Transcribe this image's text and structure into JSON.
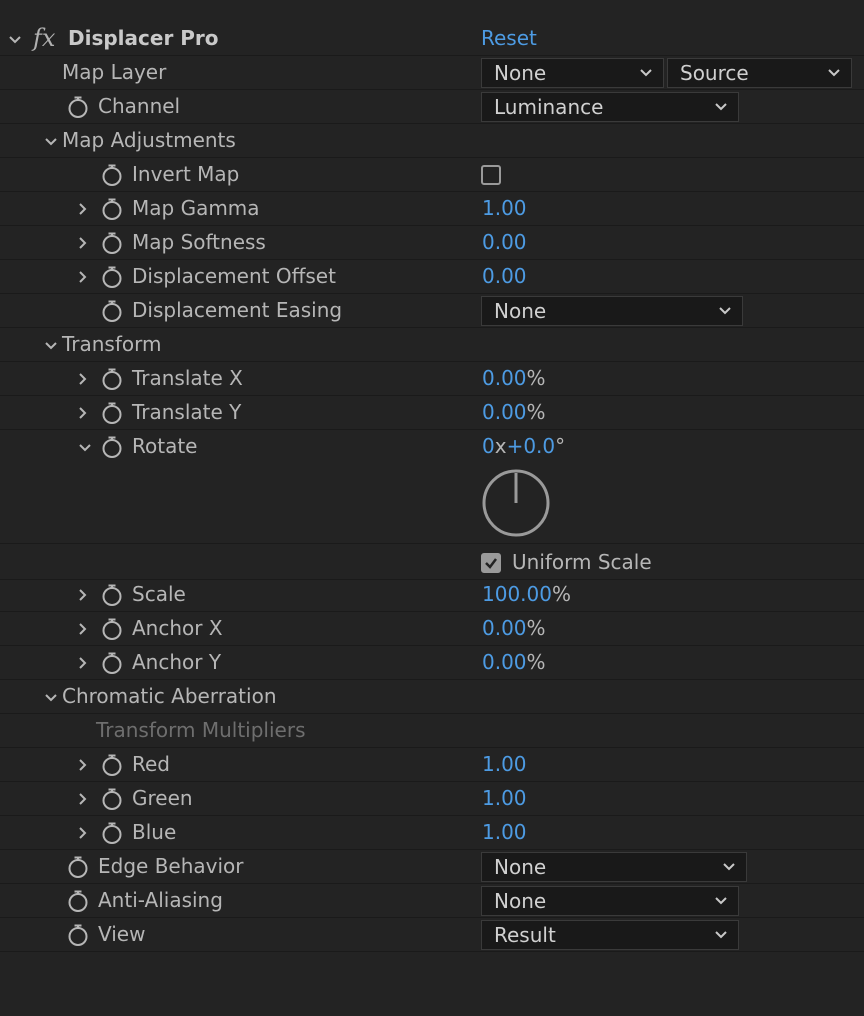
{
  "effect": {
    "name": "Displacer Pro",
    "fx_glyph": "fx",
    "reset_label": "Reset"
  },
  "map_layer": {
    "label": "Map Layer",
    "layer_value": "None",
    "source_value": "Source"
  },
  "channel": {
    "label": "Channel",
    "value": "Luminance"
  },
  "map_adjustments": {
    "label": "Map Adjustments",
    "invert_map": {
      "label": "Invert Map",
      "checked": false
    },
    "map_gamma": {
      "label": "Map Gamma",
      "value": "1.00"
    },
    "map_softness": {
      "label": "Map Softness",
      "value": "0.00"
    },
    "displacement_offset": {
      "label": "Displacement Offset",
      "value": "0.00"
    },
    "displacement_easing": {
      "label": "Displacement Easing",
      "value": "None"
    }
  },
  "transform": {
    "label": "Transform",
    "translate_x": {
      "label": "Translate X",
      "value": "0.00",
      "unit": "%"
    },
    "translate_y": {
      "label": "Translate Y",
      "value": "0.00",
      "unit": "%"
    },
    "rotate": {
      "label": "Rotate",
      "revolutions": "0",
      "rev_sep": "x",
      "degrees": "+0.0",
      "deg_unit": "°"
    },
    "uniform_scale": {
      "label": "Uniform Scale",
      "checked": true
    },
    "scale": {
      "label": "Scale",
      "value": "100.00",
      "unit": "%"
    },
    "anchor_x": {
      "label": "Anchor X",
      "value": "0.00",
      "unit": "%"
    },
    "anchor_y": {
      "label": "Anchor Y",
      "value": "0.00",
      "unit": "%"
    }
  },
  "chromatic_aberration": {
    "label": "Chromatic Aberration",
    "multipliers_label": "Transform Multipliers",
    "red": {
      "label": "Red",
      "value": "1.00"
    },
    "green": {
      "label": "Green",
      "value": "1.00"
    },
    "blue": {
      "label": "Blue",
      "value": "1.00"
    }
  },
  "edge_behavior": {
    "label": "Edge Behavior",
    "value": "None"
  },
  "anti_aliasing": {
    "label": "Anti-Aliasing",
    "value": "None"
  },
  "view": {
    "label": "View",
    "value": "Result"
  },
  "colors": {
    "background": "#232323",
    "value_blue": "#4d9be3",
    "text": "#b6b6b6",
    "dim_text": "#6e6e6e"
  }
}
